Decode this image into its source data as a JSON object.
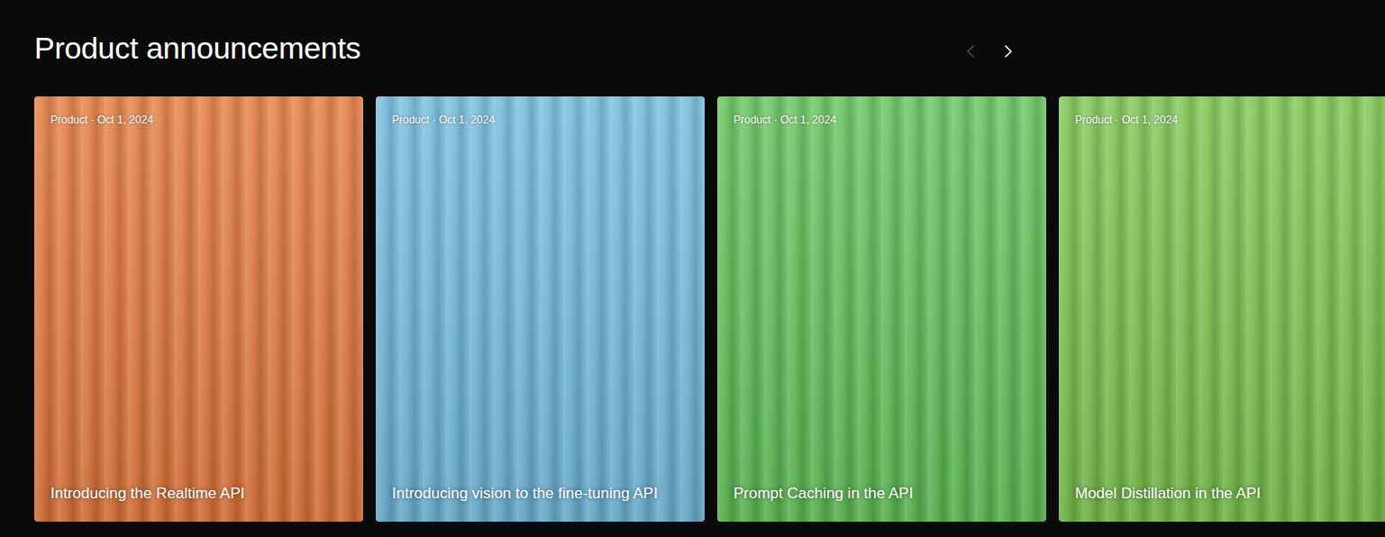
{
  "section": {
    "title": "Product announcements"
  },
  "nav": {
    "prev": {
      "disabled": true
    },
    "next": {
      "disabled": false
    }
  },
  "cards": [
    {
      "meta": "Product · Oct 1, 2024",
      "title": "Introducing the Realtime API",
      "color": "#e2763a"
    },
    {
      "meta": "Product · Oct 1, 2024",
      "title": "Introducing vision to the fine-tuning API",
      "color": "#6fb8dc"
    },
    {
      "meta": "Product · Oct 1, 2024",
      "title": "Prompt Caching in the API",
      "color": "#5fbf55"
    },
    {
      "meta": "Product · Oct 1, 2024",
      "title": "Model Distillation in the API",
      "color": "#78c24c"
    }
  ]
}
